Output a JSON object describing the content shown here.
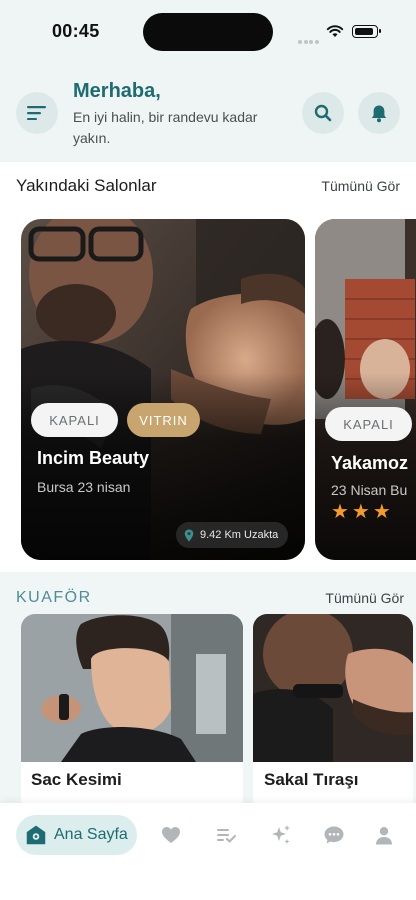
{
  "status_bar": {
    "time": "00:45"
  },
  "header": {
    "greeting": "Merhaba,",
    "subtitle": "En iyi halin, bir randevu kadar yakın."
  },
  "nearby": {
    "title": "Yakındaki Salonlar",
    "see_all": "Tümünü Gör",
    "cards": [
      {
        "status": "KAPALI",
        "badge": "VITRIN",
        "name": "Incim Beauty",
        "location": "Bursa 23 nisan",
        "distance": "9.42 Km Uzakta"
      },
      {
        "status": "KAPALI",
        "name": "Yakamoz",
        "location": "23 Nisan Bu",
        "rating": "★★★"
      }
    ]
  },
  "kuafor": {
    "title": "KUAFÖR",
    "see_all": "Tümünü Gör",
    "services": [
      {
        "name": "Sac Kesimi"
      },
      {
        "name": "Sakal Tıraşı"
      }
    ]
  },
  "tabbar": {
    "active_label": "Ana Sayfa",
    "icons": [
      "home-icon",
      "heart-icon",
      "checklist-icon",
      "sparkles-icon",
      "chat-icon",
      "profile-icon"
    ]
  },
  "colors": {
    "accent": "#1f6b72",
    "vitrin": "#c8a46e",
    "star": "#f29a2e"
  }
}
